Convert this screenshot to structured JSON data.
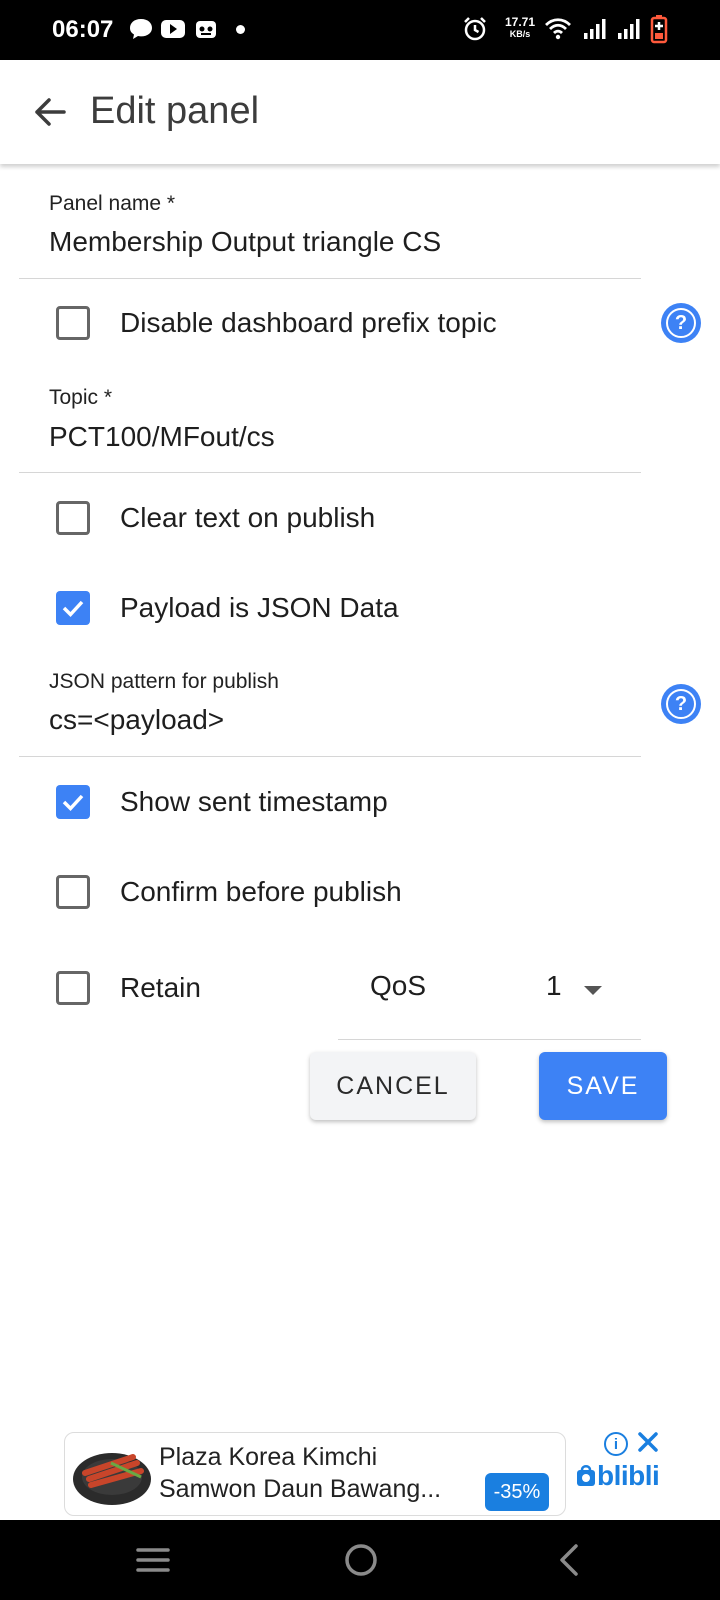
{
  "status_bar": {
    "time": "06:07",
    "net_speed_value": "17.71",
    "net_speed_unit": "KB/s",
    "icons": [
      "chat-icon",
      "youtube-icon",
      "app-icon",
      "dot-icon",
      "alarm-icon",
      "wifi-icon",
      "signal-icon",
      "signal-icon",
      "battery-icon"
    ]
  },
  "appbar": {
    "title": "Edit panel"
  },
  "form": {
    "panel_name": {
      "label": "Panel name *",
      "value": "Membership Output triangle CS"
    },
    "disable_prefix": {
      "label": "Disable dashboard prefix topic",
      "checked": false
    },
    "topic": {
      "label": "Topic *",
      "value": "PCT100/MFout/cs"
    },
    "clear_text": {
      "label": "Clear text on publish",
      "checked": false
    },
    "payload_json": {
      "label": "Payload is JSON Data",
      "checked": true
    },
    "json_pattern": {
      "label": "JSON pattern for publish",
      "value": "cs=<payload>"
    },
    "show_timestamp": {
      "label": "Show sent timestamp",
      "checked": true
    },
    "confirm_publish": {
      "label": "Confirm before publish",
      "checked": false
    },
    "retain": {
      "label": "Retain",
      "checked": false
    },
    "qos": {
      "label": "QoS",
      "value": "1"
    }
  },
  "buttons": {
    "cancel": "CANCEL",
    "save": "SAVE"
  },
  "ad": {
    "line1": "Plaza Korea Kimchi",
    "line2": "Samwon Daun Bawang...",
    "discount": "-35%",
    "brand": "blibli"
  },
  "colors": {
    "accent": "#3d82f5",
    "status_bar": "#000000",
    "nav_bar": "#000000",
    "ad_blue": "#1a7fe0"
  }
}
